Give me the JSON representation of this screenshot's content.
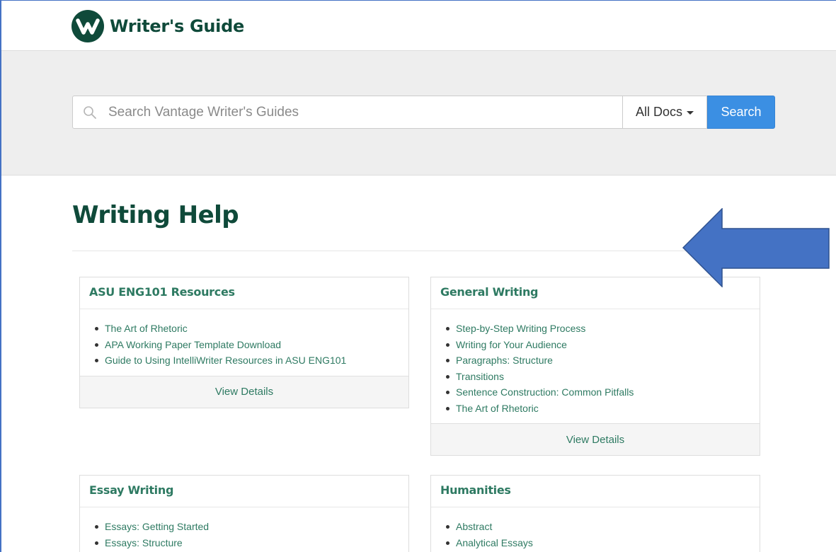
{
  "brand": {
    "name": "Writer's Guide",
    "logo_color": "#0f4a3a"
  },
  "search": {
    "placeholder": "Search Vantage Writer's Guides",
    "scope": "All Docs",
    "button_label": "Search",
    "button_color": "#3b8fe3"
  },
  "page": {
    "title": "Writing Help"
  },
  "cards": [
    {
      "title": "ASU ENG101 Resources",
      "items": [
        "The Art of Rhetoric",
        "APA Working Paper Template Download",
        "Guide to Using IntelliWriter Resources in ASU ENG101"
      ],
      "footer": "View Details"
    },
    {
      "title": "General Writing",
      "items": [
        "Step-by-Step Writing Process",
        "Writing for Your Audience",
        "Paragraphs: Structure",
        "Transitions",
        "Sentence Construction: Common Pitfalls",
        "The Art of Rhetoric"
      ],
      "footer": "View Details"
    },
    {
      "title": "Essay Writing",
      "items": [
        "Essays: Getting Started",
        "Essays: Structure"
      ]
    },
    {
      "title": "Humanities",
      "items": [
        "Abstract",
        "Analytical Essays"
      ]
    }
  ],
  "colors": {
    "accent_green": "#2e7a62",
    "annotation_arrow": "#4472c4"
  }
}
